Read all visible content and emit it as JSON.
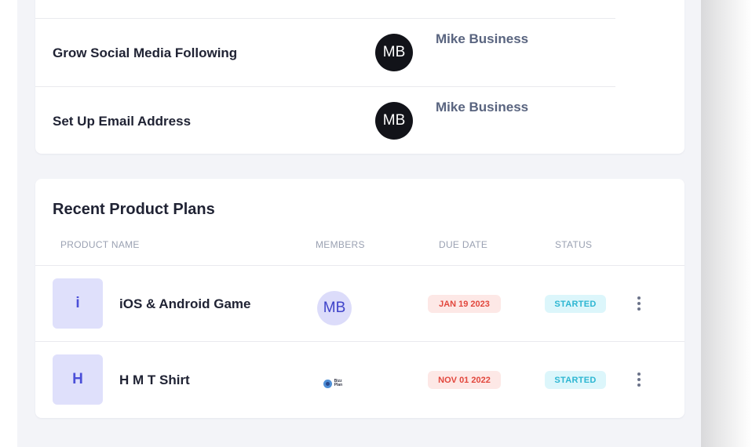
{
  "tasks": {
    "rows": [
      {
        "title": "Grow Social Media Following",
        "avatar_initials": "MB",
        "owner": "Mike Business"
      },
      {
        "title": "Set Up Email Address",
        "avatar_initials": "MB",
        "owner": "Mike Business"
      }
    ]
  },
  "plans": {
    "title": "Recent Product Plans",
    "columns": {
      "name": "PRODUCT NAME",
      "members": "MEMBERS",
      "due": "DUE DATE",
      "status": "STATUS"
    },
    "rows": [
      {
        "initial": "i",
        "name": "iOS & Android Game",
        "member_initials": "MB",
        "due": "JAN 19 2023",
        "status": "STARTED"
      },
      {
        "initial": "H",
        "name": "H M T Shirt",
        "member_logo_text": "Bizz Plan",
        "due": "NOV 01 2022",
        "status": "STARTED"
      }
    ]
  },
  "colors": {
    "accent": "#4b4fd8",
    "due_text": "#e2463c",
    "status_text": "#2cb6d2"
  },
  "icons": {
    "row_menu": "more-vertical-icon",
    "member_logo": "bizz-plan-logo-icon"
  }
}
